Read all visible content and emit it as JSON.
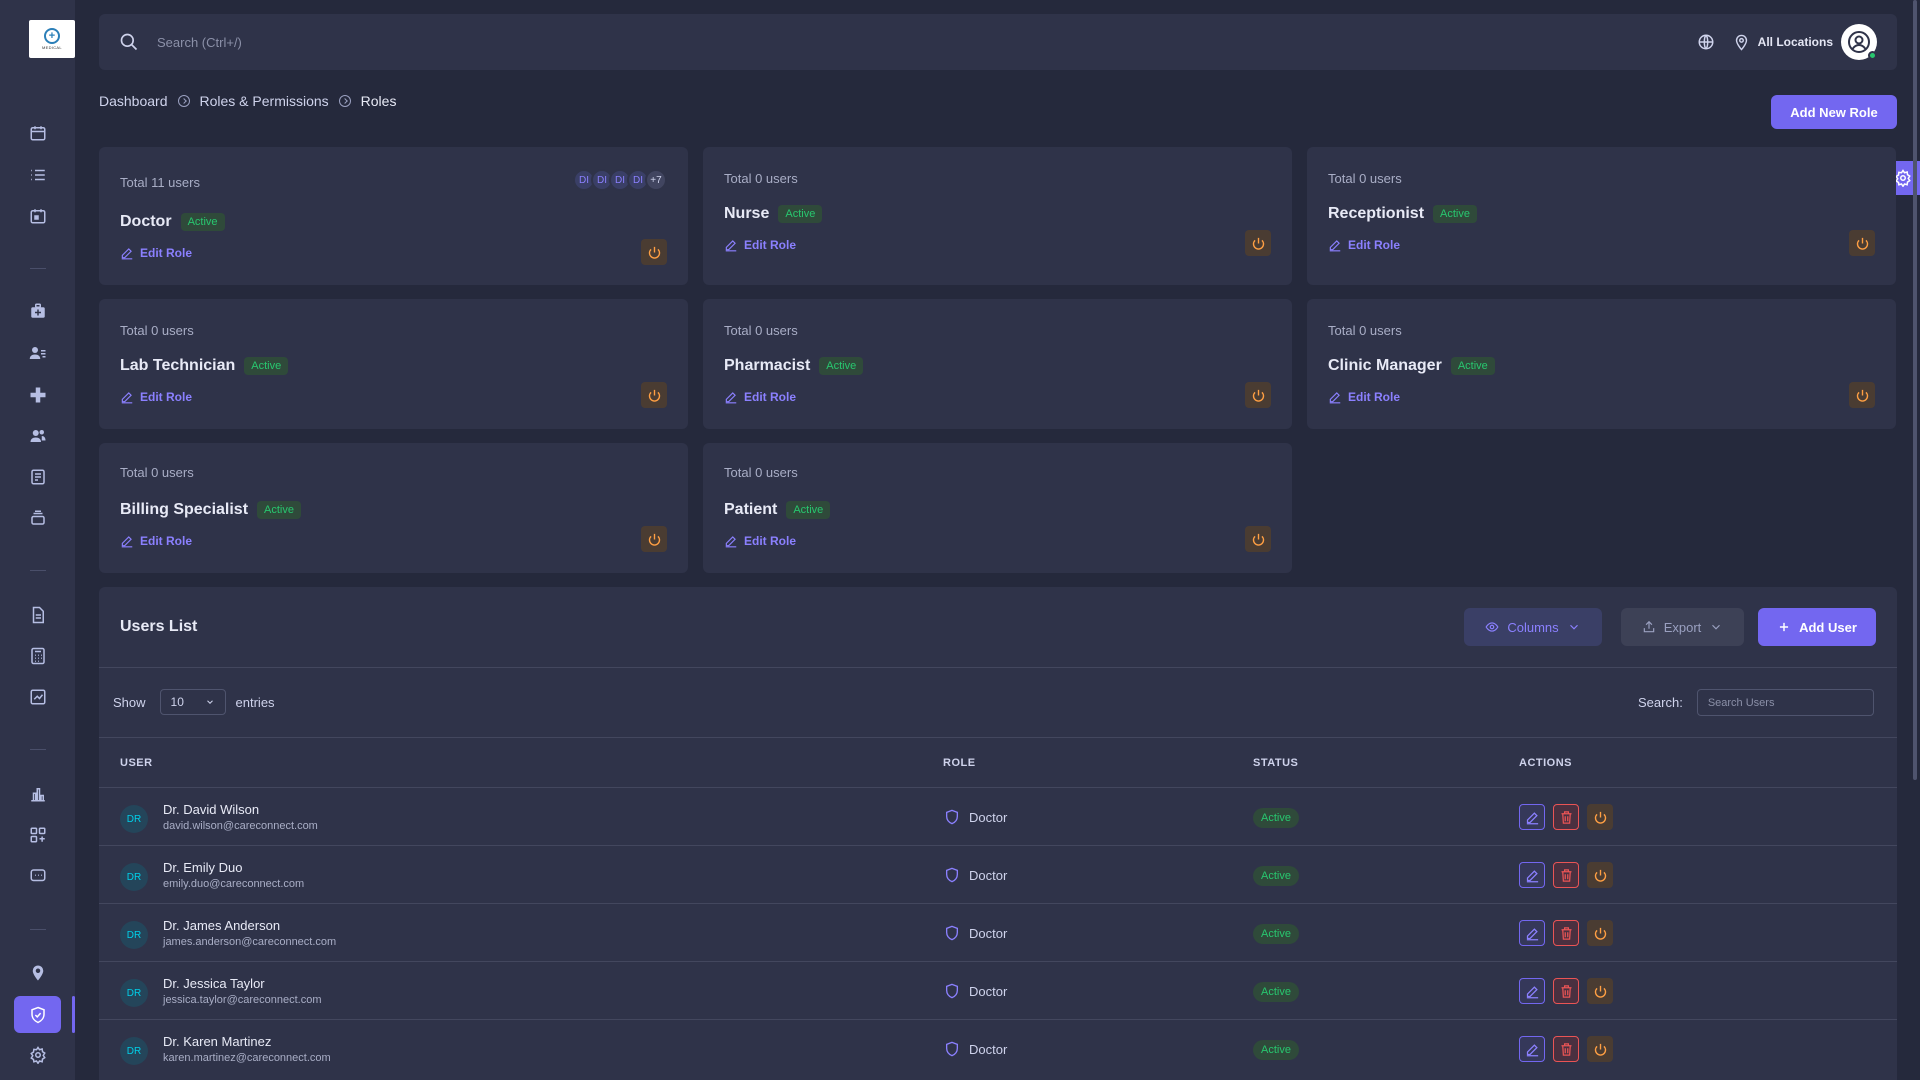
{
  "brand": {
    "logo_text": "MEDICAL"
  },
  "topbar": {
    "search_placeholder": "Search (Ctrl+/)",
    "location_label": "All Locations"
  },
  "breadcrumb": {
    "items": [
      "Dashboard",
      "Roles & Permissions",
      "Roles"
    ]
  },
  "actions": {
    "add_role": "Add New Role"
  },
  "role_cards": [
    {
      "total": "Total 11 users",
      "name": "Doctor",
      "status": "Active",
      "edit": "Edit Role",
      "avatars": [
        "DI",
        "DI",
        "DI",
        "DI"
      ],
      "more": "+7"
    },
    {
      "total": "Total 0 users",
      "name": "Nurse",
      "status": "Active",
      "edit": "Edit Role"
    },
    {
      "total": "Total 0 users",
      "name": "Receptionist",
      "status": "Active",
      "edit": "Edit Role"
    },
    {
      "total": "Total 0 users",
      "name": "Lab Technician",
      "status": "Active",
      "edit": "Edit Role"
    },
    {
      "total": "Total 0 users",
      "name": "Pharmacist",
      "status": "Active",
      "edit": "Edit Role"
    },
    {
      "total": "Total 0 users",
      "name": "Clinic Manager",
      "status": "Active",
      "edit": "Edit Role"
    },
    {
      "total": "Total 0 users",
      "name": "Billing Specialist",
      "status": "Active",
      "edit": "Edit Role"
    },
    {
      "total": "Total 0 users",
      "name": "Patient",
      "status": "Active",
      "edit": "Edit Role"
    }
  ],
  "users_list": {
    "title": "Users List",
    "columns_button": "Columns",
    "export_button": "Export",
    "add_user_button": "Add User",
    "show_label": "Show",
    "page_size": "10",
    "entries_label": "entries",
    "search_label": "Search:",
    "search_placeholder": "Search Users",
    "headers": {
      "user": "USER",
      "role": "ROLE",
      "status": "STATUS",
      "actions": "ACTIONS"
    },
    "rows": [
      {
        "initials": "DR",
        "name": "Dr. David Wilson",
        "email": "david.wilson@careconnect.com",
        "role": "Doctor",
        "status": "Active"
      },
      {
        "initials": "DR",
        "name": "Dr. Emily Duo",
        "email": "emily.duo@careconnect.com",
        "role": "Doctor",
        "status": "Active"
      },
      {
        "initials": "DR",
        "name": "Dr. James Anderson",
        "email": "james.anderson@careconnect.com",
        "role": "Doctor",
        "status": "Active"
      },
      {
        "initials": "DR",
        "name": "Dr. Jessica Taylor",
        "email": "jessica.taylor@careconnect.com",
        "role": "Doctor",
        "status": "Active"
      },
      {
        "initials": "DR",
        "name": "Dr. Karen Martinez",
        "email": "karen.martinez@careconnect.com",
        "role": "Doctor",
        "status": "Active"
      }
    ]
  },
  "colors": {
    "accent": "#7367f0",
    "success": "#28c76f",
    "warning": "#ff9f43",
    "danger": "#ea5455",
    "background": "#25293c",
    "surface": "#2f3349"
  }
}
